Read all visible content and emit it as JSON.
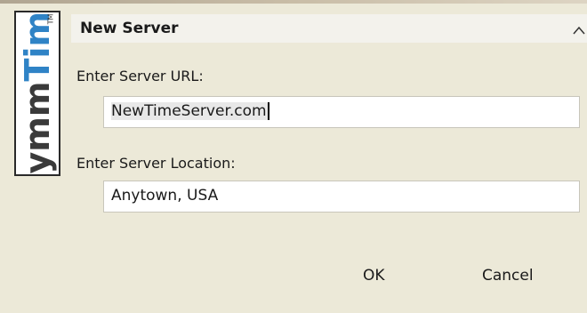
{
  "dialog": {
    "title": "New Server",
    "logo_text_left": "Symm",
    "logo_text_right": "Time",
    "logo_tm": "TM"
  },
  "fields": {
    "url_label": "Enter Server URL:",
    "url_value": "NewTimeServer.com",
    "location_label": "Enter Server Location:",
    "location_value": "Anytown, USA"
  },
  "buttons": {
    "ok": "OK",
    "cancel": "Cancel"
  },
  "colors": {
    "accent": "#2f83c6",
    "background": "#ece9d8"
  }
}
